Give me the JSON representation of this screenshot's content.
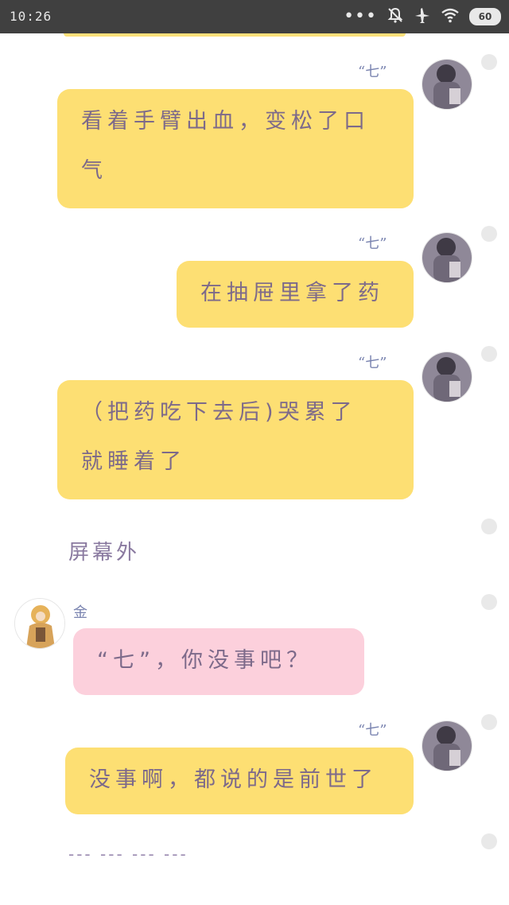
{
  "status_bar": {
    "time": "10:26",
    "battery": "60",
    "icons": [
      "more-dots-icon",
      "bell-muted-icon",
      "airplane-icon",
      "wifi-icon",
      "battery-icon"
    ]
  },
  "messages": [
    {
      "side": "right",
      "sender_name": "“七”",
      "text_line1": "看着手臂出血，变松了口",
      "text_line2": "气"
    },
    {
      "side": "right",
      "sender_name": "“七”",
      "text_line1": "在抽屉里拿了药"
    },
    {
      "side": "right",
      "sender_name": "“七”",
      "text_line1": "（把药吃下去后)哭累了",
      "text_line2": "就睡着了"
    },
    {
      "side": "narration",
      "text": "屏幕外"
    },
    {
      "side": "left",
      "sender_name": "金",
      "text_line1": "“七”，你没事吧？"
    },
    {
      "side": "right",
      "sender_name": "“七”",
      "text_line1": "没事啊，都说的是前世了"
    },
    {
      "side": "narration",
      "text": "--- --- --- ---"
    }
  ],
  "colors": {
    "status_bar": "#404040",
    "bubble_yellow": "#fddf73",
    "bubble_pink": "#fcd0dc",
    "text": "#7d6a8a"
  }
}
